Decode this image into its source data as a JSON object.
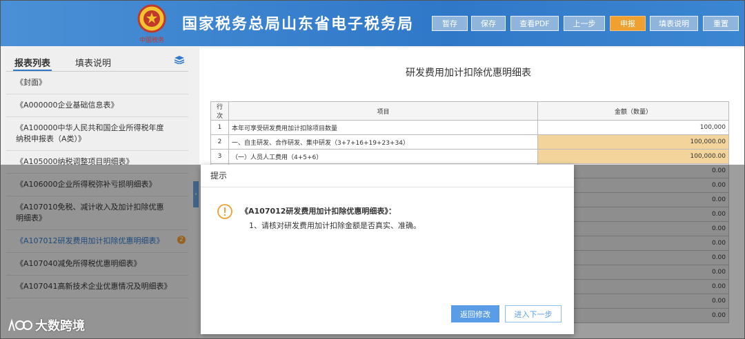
{
  "header": {
    "emblem_text": "中国税务",
    "title": "国家税务总局山东省电子税务局",
    "buttons": [
      {
        "label": "暂存",
        "active": false
      },
      {
        "label": "保存",
        "active": false
      },
      {
        "label": "查看PDF",
        "active": false
      },
      {
        "label": "上一步",
        "active": false
      },
      {
        "label": "申报",
        "active": true
      },
      {
        "label": "填表说明",
        "active": false
      },
      {
        "label": "重置",
        "active": false
      }
    ]
  },
  "sidebar": {
    "tabs": [
      "报表列表",
      "填表说明"
    ],
    "active_tab": "报表列表",
    "items": [
      {
        "label": "《封面》"
      },
      {
        "label": "《A000000企业基础信息表》"
      },
      {
        "label": "《A100000中华人民共和国企业所得税年度纳税申报表（A类）》"
      },
      {
        "label": "《A105000纳税调整项目明细表》"
      },
      {
        "label": "《A106000企业所得税弥补亏损明细表》"
      },
      {
        "label": "《A107010免税、减计收入及加计扣除优惠明细表》"
      },
      {
        "label": "《A107012研发费用加计扣除优惠明细表》",
        "active": true,
        "badge": "2"
      },
      {
        "label": "《A107040减免所得税优惠明细表》"
      },
      {
        "label": "《A107041高新技术企业优惠情况及明细表》"
      }
    ]
  },
  "main": {
    "title": "研发费用加计扣除优惠明细表",
    "table": {
      "headers": [
        "行次",
        "项目",
        "金额（数量）"
      ],
      "rows": [
        {
          "no": "1",
          "item": "本年可享受研发费用加计扣除项目数量",
          "amount": "100,000",
          "style": "white"
        },
        {
          "no": "2",
          "item": "一、自主研发、合作研发、集中研发（3+7+16+19+23+34）",
          "amount": "100,000.00",
          "style": "yellow"
        },
        {
          "no": "3",
          "item": "（一）人员人工费用（4+5+6）",
          "amount": "100,000.00",
          "style": "yellow"
        },
        {
          "no": "",
          "item": "",
          "amount": "0.00",
          "style": "grey"
        },
        {
          "no": "",
          "item": "",
          "amount": "0.00",
          "style": "grey"
        },
        {
          "no": "",
          "item": "",
          "amount": "0.00",
          "style": "grey"
        },
        {
          "no": "",
          "item": "",
          "amount": "0.00",
          "style": "grey"
        },
        {
          "no": "",
          "item": "",
          "amount": "0.00",
          "style": "grey"
        },
        {
          "no": "",
          "item": "",
          "amount": "0.00",
          "style": "grey"
        },
        {
          "no": "",
          "item": "",
          "amount": "0.00",
          "style": "grey"
        },
        {
          "no": "",
          "item": "",
          "amount": "0.00",
          "style": "grey"
        },
        {
          "no": "",
          "item": "",
          "amount": "0.00",
          "style": "grey"
        },
        {
          "no": "",
          "item": "",
          "amount": "0.00",
          "style": "grey"
        },
        {
          "no": "",
          "item": "",
          "amount": "0.00",
          "style": "grey"
        }
      ]
    }
  },
  "dialog": {
    "title": "提示",
    "heading": "《A107012研发费用加计扣除优惠明细表》：",
    "message": "1、请核对研发费用加计扣除金额是否真实、准确。",
    "primary_button": "返回修改",
    "secondary_button": "进入下一步"
  },
  "watermark": "大数跨境",
  "colors": {
    "header_blue": "#2f78c8",
    "accent_orange": "#f0a030",
    "button_blue": "#5a9de6"
  }
}
